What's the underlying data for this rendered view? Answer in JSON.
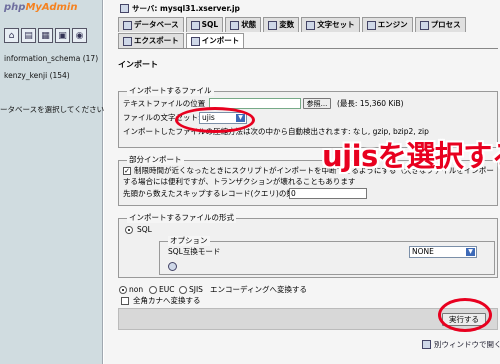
{
  "left": {
    "logo_php": "php",
    "logo_myadmin": "MyAdmin",
    "icons": [
      {
        "name": "home-icon",
        "glyph": "⌂"
      },
      {
        "name": "query-window-icon",
        "glyph": "▤"
      },
      {
        "name": "sql-icon",
        "glyph": "▦"
      },
      {
        "name": "docs-icon",
        "glyph": "▣"
      },
      {
        "name": "reload-icon",
        "glyph": "◉"
      }
    ],
    "databases": [
      "information_schema (17)",
      "kenzy_kenji (154)"
    ],
    "hint": "ータベースを選択してください"
  },
  "header": {
    "server_label": "サーバ: mysql31.xserver.jp"
  },
  "tabs": {
    "row1": [
      "データベース",
      "SQL",
      "状態",
      "変数",
      "文字セット",
      "エンジン",
      "プロセス"
    ],
    "row2": [
      "エクスポート",
      "インポート"
    ]
  },
  "import": {
    "title": "インポート",
    "file_legend": "インポートするファイル",
    "file_location_label": "テキストファイルの位置",
    "browse_button": "参照...",
    "max_size": "(最長: 15,360 KiB)",
    "charset_label": "ファイルの文字セット:",
    "charset_value": "ujis",
    "compression_note": "インポートしたファイルの圧縮方法は次の中から自動検出されます: なし, gzip, bzip2, zip",
    "partial_legend": "部分インポート",
    "partial_line1": "制限時間が近くなったときにスクリプトがインポートを中断できるようにする（大きなファイルをインポートする場合には便利ですが、トランザクションが壊れることもあります",
    "partial_line2_prefix": "する場合には便利ですが、トランザクションが壊れることもあります",
    "skip_label": "先頭から数えたスキップするレコード(クエリ)の数",
    "skip_value": "0",
    "format_legend": "インポートするファイルの形式",
    "format_sql": "SQL",
    "options_legend": "オプション",
    "compat_label": "SQL互換モード",
    "compat_value": "NONE",
    "encoding_options": [
      "non",
      "EUC",
      "SJIS"
    ],
    "encoding_note": "エンコーディングへ変換する",
    "kana_label": "全角カナへ変換する",
    "execute_button": "実行する",
    "new_window_link": "別ウィンドウで開く"
  },
  "annotation": {
    "text": "ujisを選択する",
    "color": "#e8001f"
  }
}
